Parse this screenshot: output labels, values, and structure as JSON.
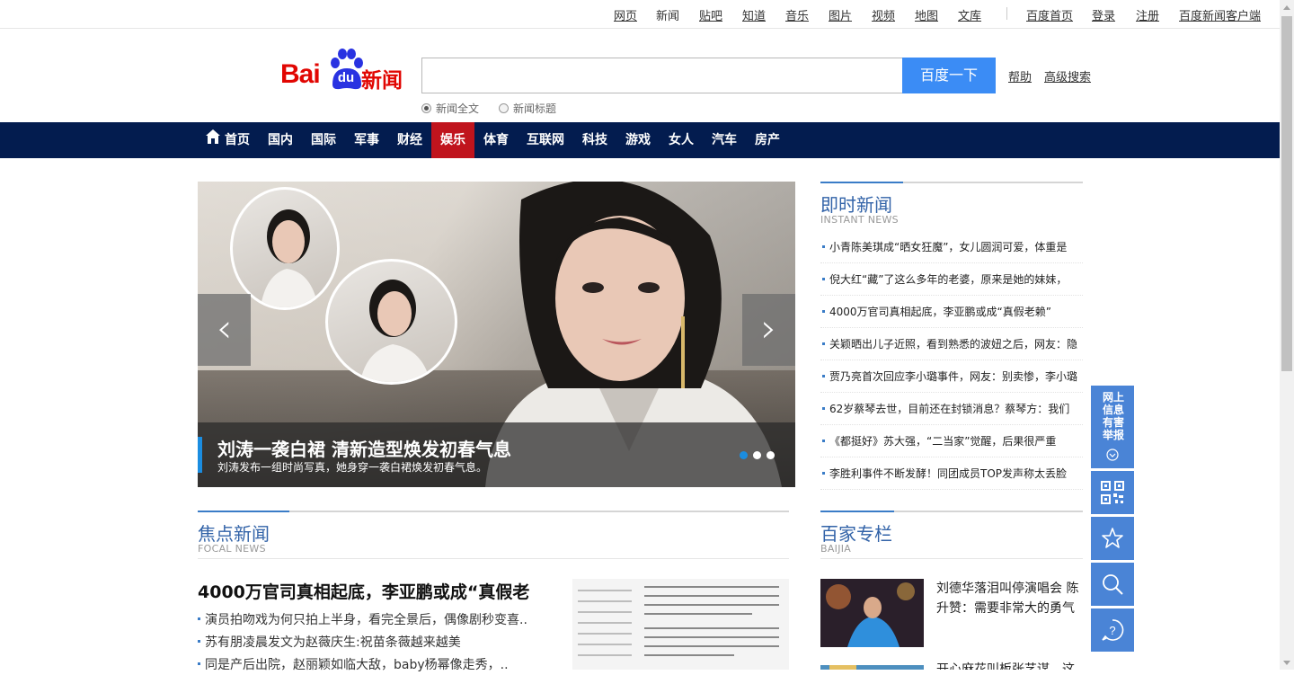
{
  "top_links": {
    "web": "网页",
    "news": "新闻",
    "tieba": "贴吧",
    "zhidao": "知道",
    "music": "音乐",
    "image": "图片",
    "video": "视频",
    "map": "地图",
    "wenku": "文库",
    "home": "百度首页",
    "login": "登录",
    "register": "注册",
    "client": "百度新闻客户端"
  },
  "logo": {
    "bai": "Bai",
    "du": "du",
    "news": "新闻"
  },
  "search": {
    "button": "百度一下",
    "help": "帮助",
    "advanced": "高级搜索",
    "option_fulltext": "新闻全文",
    "option_title": "新闻标题",
    "selected_option": "新闻全文"
  },
  "nav": {
    "items": [
      "首页",
      "国内",
      "国际",
      "军事",
      "财经",
      "娱乐",
      "体育",
      "互联网",
      "科技",
      "游戏",
      "女人",
      "汽车",
      "房产"
    ],
    "active": "娱乐"
  },
  "slider": {
    "title": "刘涛一袭白裙 清新造型焕发初春气息",
    "subtitle": "刘涛发布一组时尚写真，她身穿一袭白裙焕发初春气息。",
    "prev": "‹",
    "next": "›",
    "total_slides": 3,
    "active_slide": 1
  },
  "instant_news": {
    "title": "即时新闻",
    "subtitle": "INSTANT NEWS",
    "items": [
      "小青陈美琪成“晒女狂魔”，女儿圆润可爱，体重是",
      "倪大红“藏”了这么多年的老婆，原来是她的妹妹，",
      "4000万官司真相起底，李亚鹏或成“真假老赖”",
      "关颖晒出儿子近照，看到熟悉的波妞之后，网友：隐",
      "贾乃亮首次回应李小璐事件，网友：别卖惨，李小璐",
      "62岁蔡琴去世，目前还在封锁消息？蔡琴方：我们",
      "《都挺好》苏大强，“二当家”觉醒，后果很严重",
      "李胜利事件不断发酵！同团成员TOP发声称太丢脸"
    ]
  },
  "focal_news": {
    "title": "焦点新闻",
    "subtitle": "FOCAL NEWS",
    "headline": "4000万官司真相起底，李亚鹏或成“真假老",
    "items": [
      "演员拍吻戏为何只拍上半身，看完全景后，偶像剧秒变喜..",
      "苏有朋凌晨发文为赵薇庆生:祝苗条薇越来越美",
      "同是产后出院，赵丽颖如临大敌，baby杨幂像走秀，.."
    ]
  },
  "baijia": {
    "title": "百家专栏",
    "subtitle": "BAIJIA",
    "items": [
      "刘德华落泪叫停演唱会 陈升赞：需要非常大的勇气",
      "开心麻花叫板张艺谋，这"
    ]
  },
  "side_float": {
    "report": "网上信息有害举报"
  },
  "colors": {
    "brand_red": "#e10602",
    "nav_bg": "#031c4f",
    "nav_active": "#c0141d",
    "search_button": "#3b8cf5",
    "section_blue": "#3263a8",
    "float_blue": "#4a84d6"
  }
}
